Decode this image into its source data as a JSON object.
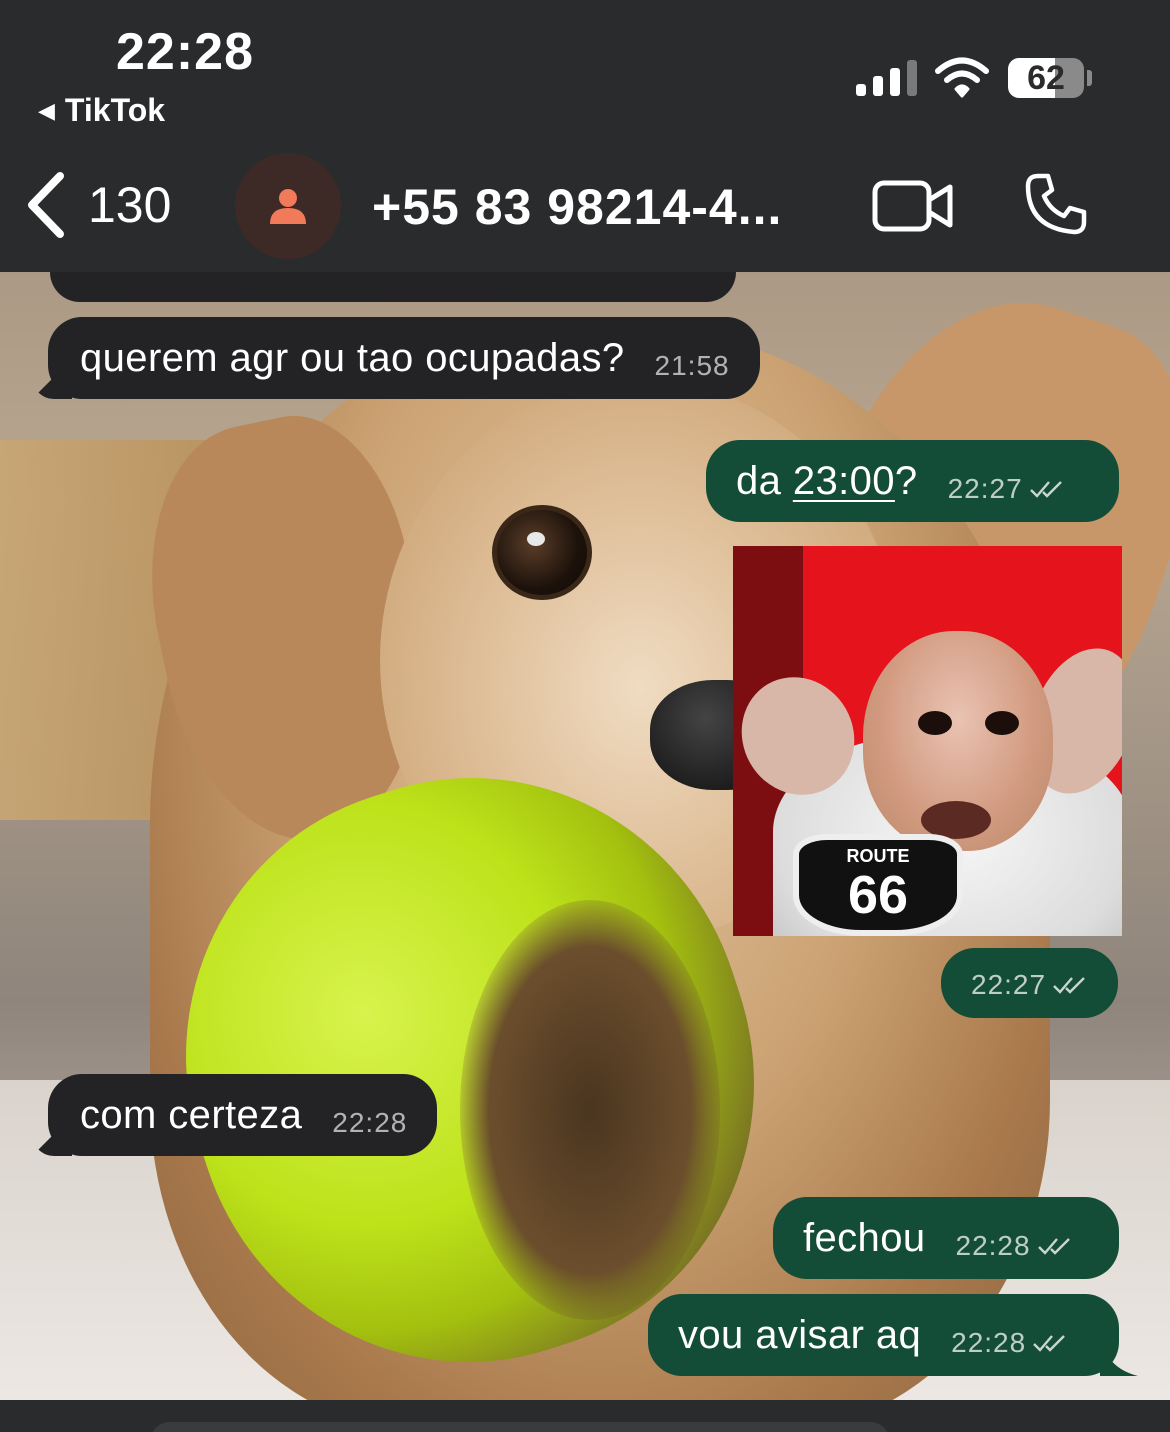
{
  "status_bar": {
    "time": "22:28",
    "back_app": "TikTok",
    "battery": "62",
    "icons": [
      "signal-icon",
      "wifi-icon",
      "battery-icon"
    ]
  },
  "header": {
    "unread_count": "130",
    "contact_name": "+55 83 98214-4...",
    "icons": [
      "chevron-left-icon",
      "person-icon",
      "video-call-icon",
      "phone-icon"
    ],
    "accent_color": "#f07a5a"
  },
  "messages": [
    {
      "direction": "in",
      "text": "",
      "time": ""
    },
    {
      "direction": "in",
      "text": "querem agr ou tao ocupadas?",
      "time": "21:58"
    },
    {
      "direction": "out",
      "text_before": "da ",
      "text_link": "23:00",
      "text_after": "?",
      "time": "22:27",
      "status": "read"
    },
    {
      "direction": "out",
      "type": "sticker",
      "sticker_text": "66",
      "sticker_caption": "ROUTE",
      "time": "22:27",
      "status": "read"
    },
    {
      "direction": "in",
      "text": "com certeza",
      "time": "22:28"
    },
    {
      "direction": "out",
      "text": "fechou",
      "time": "22:28",
      "status": "read"
    },
    {
      "direction": "out",
      "text": "vou avisar aq",
      "time": "22:28",
      "status": "read"
    }
  ],
  "colors": {
    "incoming_bubble": "#232325",
    "outgoing_bubble": "#144d37",
    "header_bg": "#2a2b2d"
  }
}
